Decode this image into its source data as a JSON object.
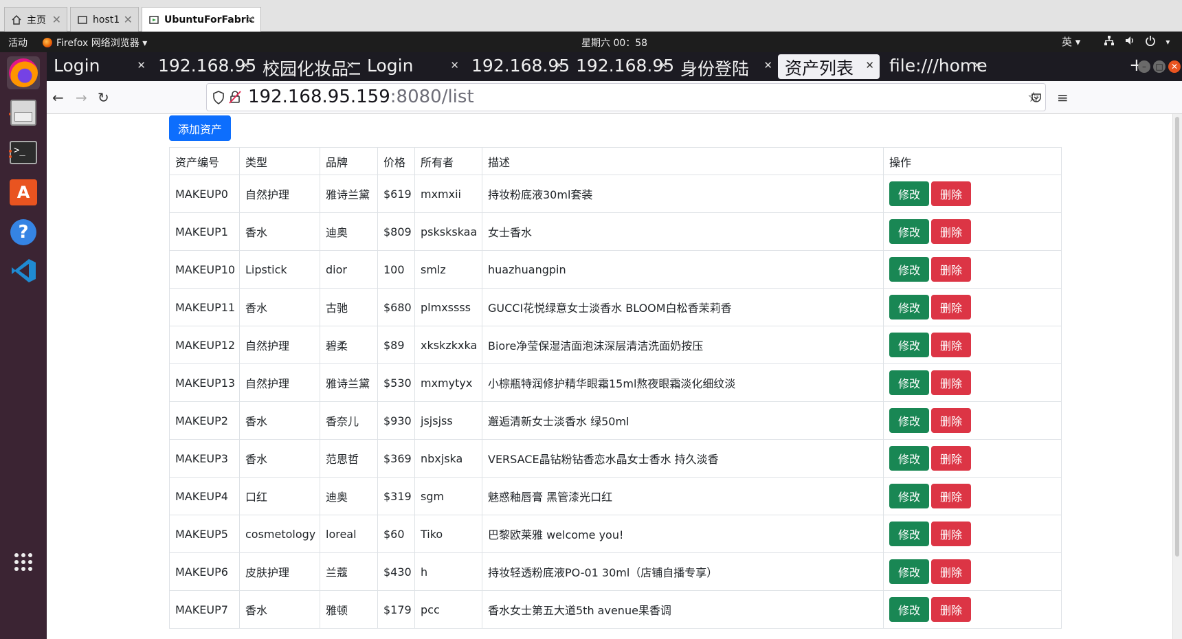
{
  "vm_tabs": [
    {
      "label": "主页"
    },
    {
      "label": "host1"
    },
    {
      "label": "UbuntuForFabric"
    }
  ],
  "gnome": {
    "activities": "活动",
    "app_menu": "Firefox 网络浏览器 ▾",
    "clock": "星期六 00：58",
    "input_method": "英 ▾"
  },
  "firefox": {
    "tabs": [
      {
        "label": "Login"
      },
      {
        "label": "192.168.95."
      },
      {
        "label": "校园化妆品二"
      },
      {
        "label": "Login"
      },
      {
        "label": "192.168.95."
      },
      {
        "label": "192.168.95."
      },
      {
        "label": "身份登陆"
      },
      {
        "label": "资产列表"
      },
      {
        "label": "file:///home"
      }
    ],
    "url_host": "192.168.95.159",
    "url_path": ":8080/list"
  },
  "page": {
    "add_button": "添加资产",
    "headers": [
      "资产编号",
      "类型",
      "品牌",
      "价格",
      "所有者",
      "描述",
      "操作"
    ],
    "edit_label": "修改",
    "delete_label": "删除",
    "rows": [
      {
        "id": "MAKEUP0",
        "type": "自然护理",
        "brand": "雅诗兰黛",
        "price": "$619",
        "owner": "mxmxii",
        "desc": "持妆粉底液30ml套装"
      },
      {
        "id": "MAKEUP1",
        "type": "香水",
        "brand": "迪奥",
        "price": "$809",
        "owner": "pskskskaa",
        "desc": "女士香水"
      },
      {
        "id": "MAKEUP10",
        "type": "Lipstick",
        "brand": "dior",
        "price": "100",
        "owner": "smlz",
        "desc": "huazhuangpin"
      },
      {
        "id": "MAKEUP11",
        "type": "香水",
        "brand": "古驰",
        "price": "$680",
        "owner": "plmxssss",
        "desc": "GUCCI花悦绿意女士淡香水 BLOOM白松香茉莉香"
      },
      {
        "id": "MAKEUP12",
        "type": "自然护理",
        "brand": "碧柔",
        "price": "$89",
        "owner": "xkskzkxka",
        "desc": "Biore净莹保湿洁面泡沫深层清洁洗面奶按压"
      },
      {
        "id": "MAKEUP13",
        "type": "自然护理",
        "brand": "雅诗兰黛",
        "price": "$530",
        "owner": "mxmytyx",
        "desc": "小棕瓶特润修护精华眼霜15ml熬夜眼霜淡化细纹淡"
      },
      {
        "id": "MAKEUP2",
        "type": "香水",
        "brand": "香奈儿",
        "price": "$930",
        "owner": "jsjsjss",
        "desc": "邂逅清新女士淡香水 绿50ml"
      },
      {
        "id": "MAKEUP3",
        "type": "香水",
        "brand": "范思哲",
        "price": "$369",
        "owner": "nbxjska",
        "desc": "VERSACE晶钻粉钻香恋水晶女士香水 持久淡香"
      },
      {
        "id": "MAKEUP4",
        "type": "口红",
        "brand": "迪奥",
        "price": "$319",
        "owner": "sgm",
        "desc": "魅惑釉唇膏 黑管漆光口红"
      },
      {
        "id": "MAKEUP5",
        "type": "cosmetology",
        "brand": "loreal",
        "price": "$60",
        "owner": "Tiko",
        "desc": "巴黎欧莱雅 welcome you!"
      },
      {
        "id": "MAKEUP6",
        "type": "皮肤护理",
        "brand": "兰蔻",
        "price": "$430",
        "owner": "h",
        "desc": "持妆轻透粉底液PO-01 30ml（店铺自播专享）"
      },
      {
        "id": "MAKEUP7",
        "type": "香水",
        "brand": "雅顿",
        "price": "$179",
        "owner": "pcc",
        "desc": "香水女士第五大道5th avenue果香调"
      }
    ]
  }
}
